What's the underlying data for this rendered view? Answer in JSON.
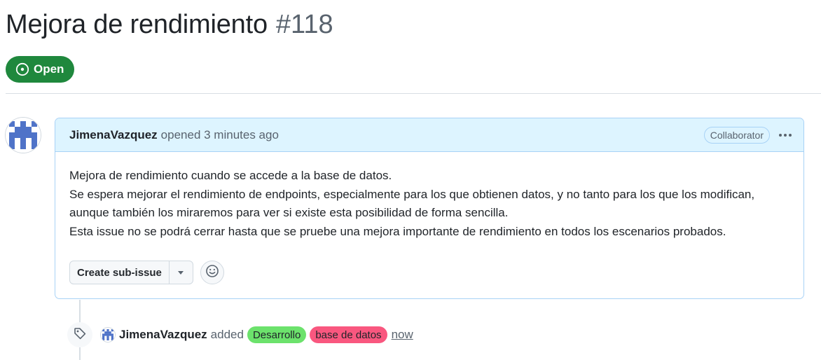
{
  "issue": {
    "title": "Mejora de rendimiento",
    "number": "#118",
    "state": "Open",
    "state_icon": "issue-opened-icon",
    "state_color": "#1f883d"
  },
  "comment": {
    "author": "JimenaVazquez",
    "opened_text": "opened 3 minutes ago",
    "role": "Collaborator",
    "more_icon": "kebab-horizontal-icon",
    "header_bg": "#ddf4ff",
    "body": [
      "Mejora de rendimiento cuando se accede a la base de datos.",
      "Se espera mejorar el rendimiento de endpoints, especialmente para los que obtienen datos, y no tanto para los que los modifican,",
      "aunque también los miraremos para ver si existe esta posibilidad de forma sencilla.",
      "Esta issue no se podrá cerrar hasta que se pruebe una mejora importante de rendimiento en todos los escenarios probados."
    ],
    "create_sub_issue_label": "Create sub-issue",
    "dropdown_icon": "triangle-down-icon",
    "reaction_icon": "smiley-icon"
  },
  "event": {
    "icon": "tag-icon",
    "actor": "JimenaVazquez",
    "verb": "added",
    "labels": [
      {
        "name": "Desarrollo",
        "color": "#6ce26c"
      },
      {
        "name": "base de datos",
        "color": "#f9577f"
      }
    ],
    "time": "now"
  }
}
